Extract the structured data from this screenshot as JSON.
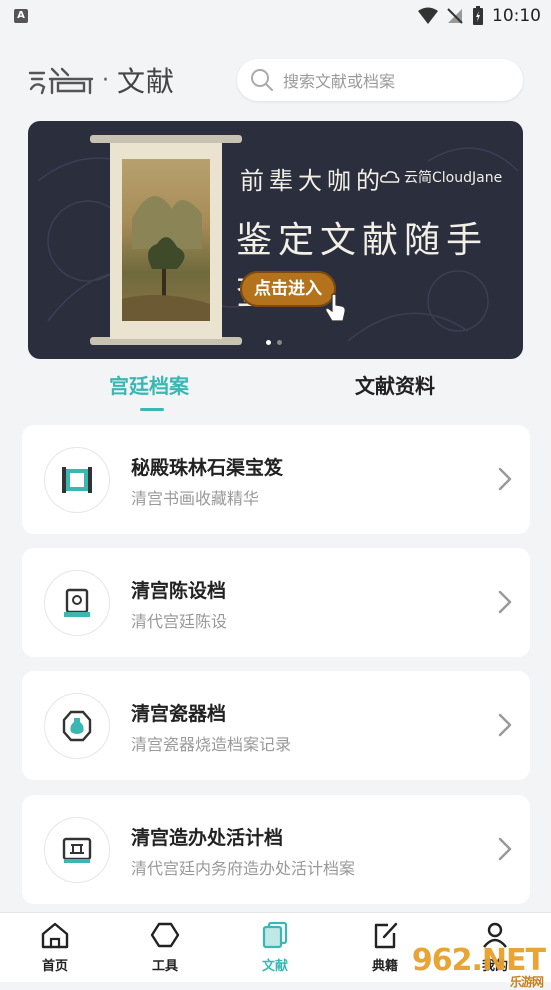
{
  "status_bar": {
    "time": "10:10",
    "notification_icon": "A"
  },
  "header": {
    "logo_text": "文献",
    "logo_prefix": "云简",
    "search_placeholder": "搜索文献或档案"
  },
  "banner": {
    "line1": "前辈大咖的",
    "brand": "云简CloudJane",
    "line2": "鉴定文献随手查",
    "button_label": "点击进入",
    "page_count": 2,
    "active_page": 1
  },
  "tabs": [
    {
      "label": "宫廷档案",
      "active": true
    },
    {
      "label": "文献资料",
      "active": false
    }
  ],
  "cards": [
    {
      "title": "秘殿珠林石渠宝笈",
      "subtitle": "清宫书画收藏精华",
      "icon": "scroll-frame-icon"
    },
    {
      "title": "清宫陈设档",
      "subtitle": "清代宫廷陈设",
      "icon": "display-cabinet-icon"
    },
    {
      "title": "清宫瓷器档",
      "subtitle": "清宫瓷器烧造档案记录",
      "icon": "vase-icon"
    },
    {
      "title": "清宫造办处活计档",
      "subtitle": "清代宫廷内务府造办处活计档案",
      "icon": "workshop-icon"
    }
  ],
  "bottom_nav": [
    {
      "label": "首页",
      "icon": "home-icon"
    },
    {
      "label": "工具",
      "icon": "hexagon-icon"
    },
    {
      "label": "文献",
      "icon": "documents-icon",
      "active": true
    },
    {
      "label": "典籍",
      "icon": "edit-book-icon"
    },
    {
      "label": "我的",
      "icon": "user-icon"
    }
  ],
  "watermark": {
    "text": "962.NET",
    "sub": "乐游网"
  },
  "colors": {
    "accent": "#3bb7b3",
    "banner_bg": "#2a2e3d",
    "button": "#b5721d"
  }
}
